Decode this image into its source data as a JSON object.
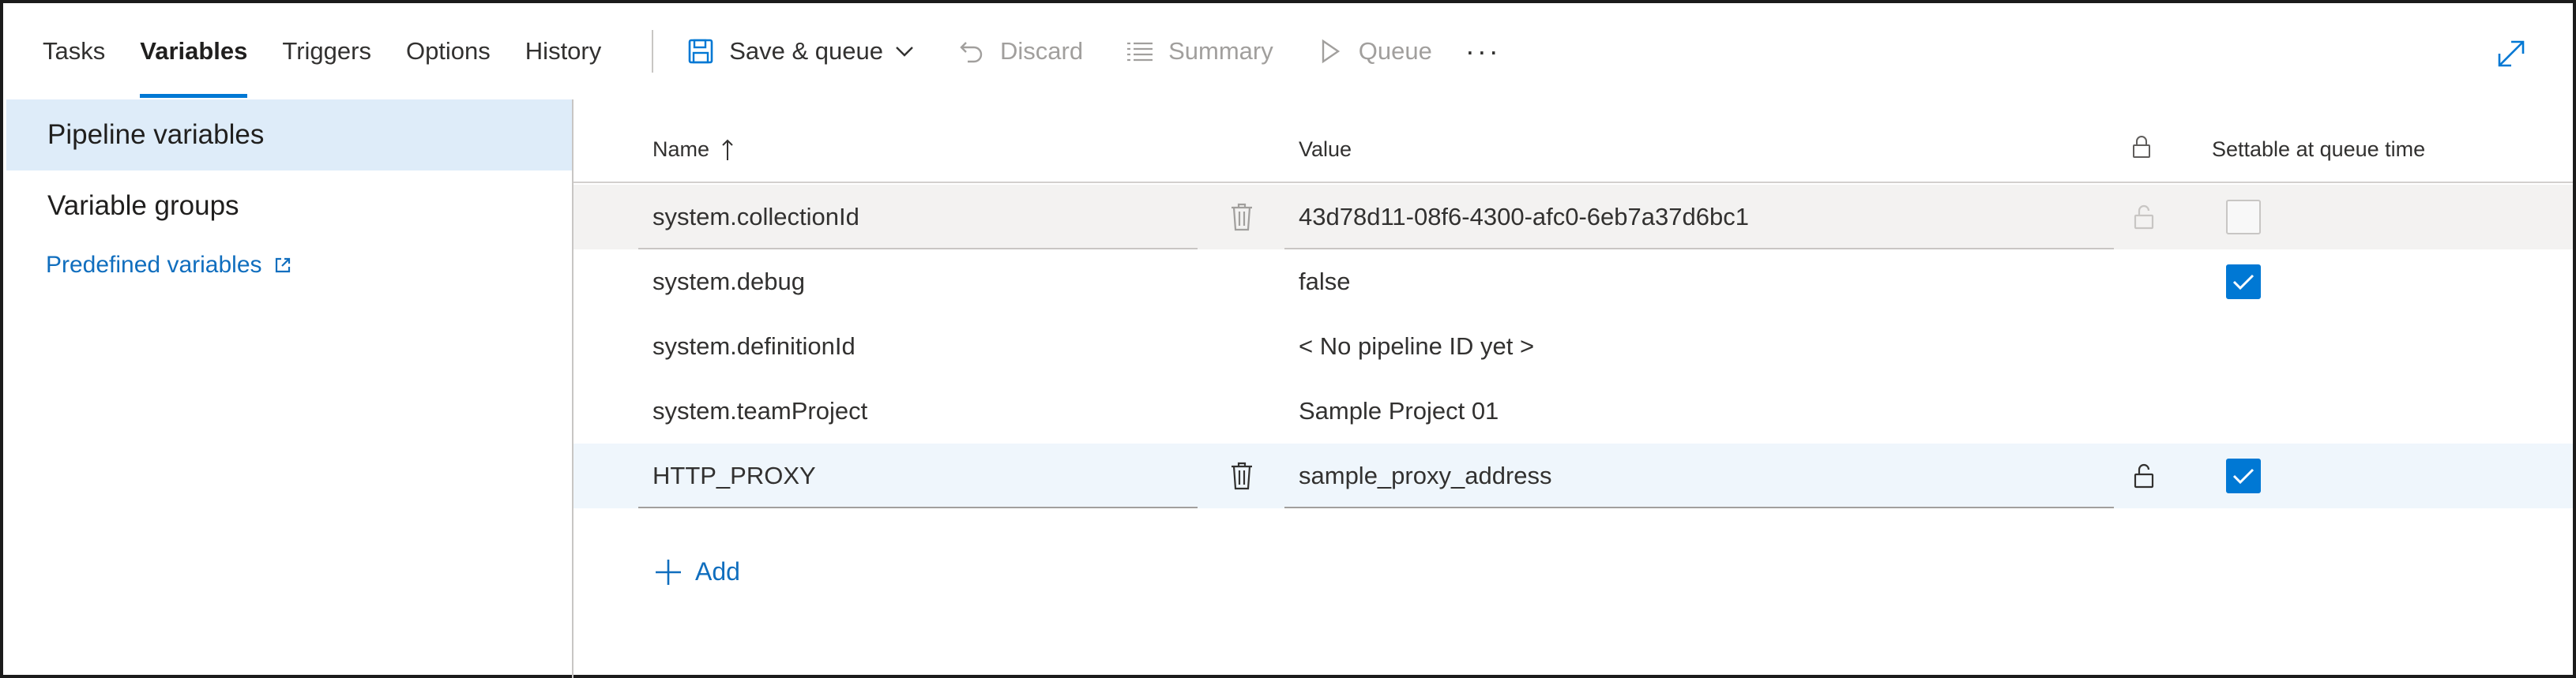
{
  "tabs": [
    {
      "label": "Tasks",
      "active": false
    },
    {
      "label": "Variables",
      "active": true
    },
    {
      "label": "Triggers",
      "active": false
    },
    {
      "label": "Options",
      "active": false
    },
    {
      "label": "History",
      "active": false
    }
  ],
  "commands": {
    "save_queue": "Save & queue",
    "discard": "Discard",
    "summary": "Summary",
    "queue": "Queue",
    "more": "···"
  },
  "nav": {
    "pipeline_variables": "Pipeline variables",
    "variable_groups": "Variable groups",
    "predefined_variables": "Predefined variables"
  },
  "grid": {
    "headers": {
      "name": "Name",
      "value": "Value",
      "settable": "Settable at queue time"
    },
    "rows": [
      {
        "name": "system.collectionId",
        "value": "43d78d11-08f6-4300-afc0-6eb7a37d6bc1",
        "settable": false,
        "editable": true,
        "readonly": true
      },
      {
        "name": "system.debug",
        "value": "false",
        "settable": true,
        "editable": false,
        "readonly": false
      },
      {
        "name": "system.definitionId",
        "value": "< No pipeline ID yet >",
        "settable": null,
        "editable": false,
        "readonly": false
      },
      {
        "name": "system.teamProject",
        "value": "Sample Project 01",
        "settable": null,
        "editable": false,
        "readonly": false
      },
      {
        "name": "HTTP_PROXY",
        "value": "sample_proxy_address",
        "settable": true,
        "editable": true,
        "readonly": false
      }
    ],
    "add_label": "Add"
  },
  "colors": {
    "accent": "#0078d4",
    "link": "#106ebe",
    "selected_nav": "#deecf9",
    "row_highlight": "#eff6fc"
  }
}
